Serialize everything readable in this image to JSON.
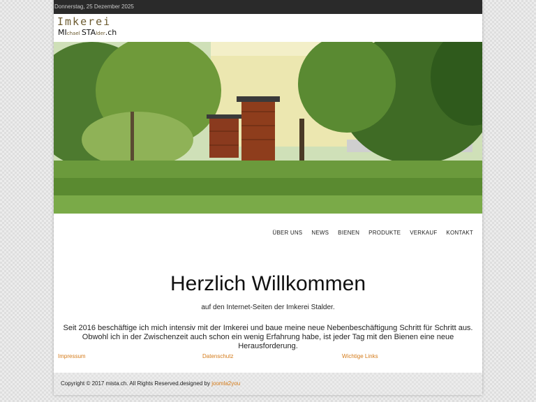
{
  "topbar": {
    "date": "Donnerstag, 25 Dezember 2025"
  },
  "logo": {
    "line1": "Imkerei",
    "part1_big": "MI",
    "part1_small": "chael ",
    "part2_big": "STA",
    "part2_small": "lder",
    "suffix": ".ch"
  },
  "nav": {
    "items": [
      {
        "label": "ÜBER UNS"
      },
      {
        "label": "NEWS"
      },
      {
        "label": "BIENEN"
      },
      {
        "label": "PRODUKTE"
      },
      {
        "label": "VERKAUF"
      },
      {
        "label": "KONTAKT"
      }
    ]
  },
  "main": {
    "title": "Herzlich Willkommen",
    "subtitle": "auf den Internet-Seiten der Imkerei Stalder.",
    "body": "Seit 2016 beschäftige ich mich intensiv mit der Imkerei und baue meine neue Nebenbeschäftigung Schritt für Schritt aus. Obwohl ich in der Zwischenzeit auch schon ein wenig Erfahrung habe, ist jeder Tag mit den Bienen eine neue Herausforderung."
  },
  "links": {
    "impressum": "Impressum",
    "datenschutz": "Datenschutz",
    "wichtige_links": "Wichtige Links"
  },
  "footer": {
    "copyright": "Copyright © 2017 mista.ch. All Rights Reserved.designed by ",
    "designer": "joomla2you"
  },
  "colors": {
    "link": "#d47b1a",
    "topbar": "#2a2a2a",
    "logo_brown": "#6b5a2f"
  }
}
